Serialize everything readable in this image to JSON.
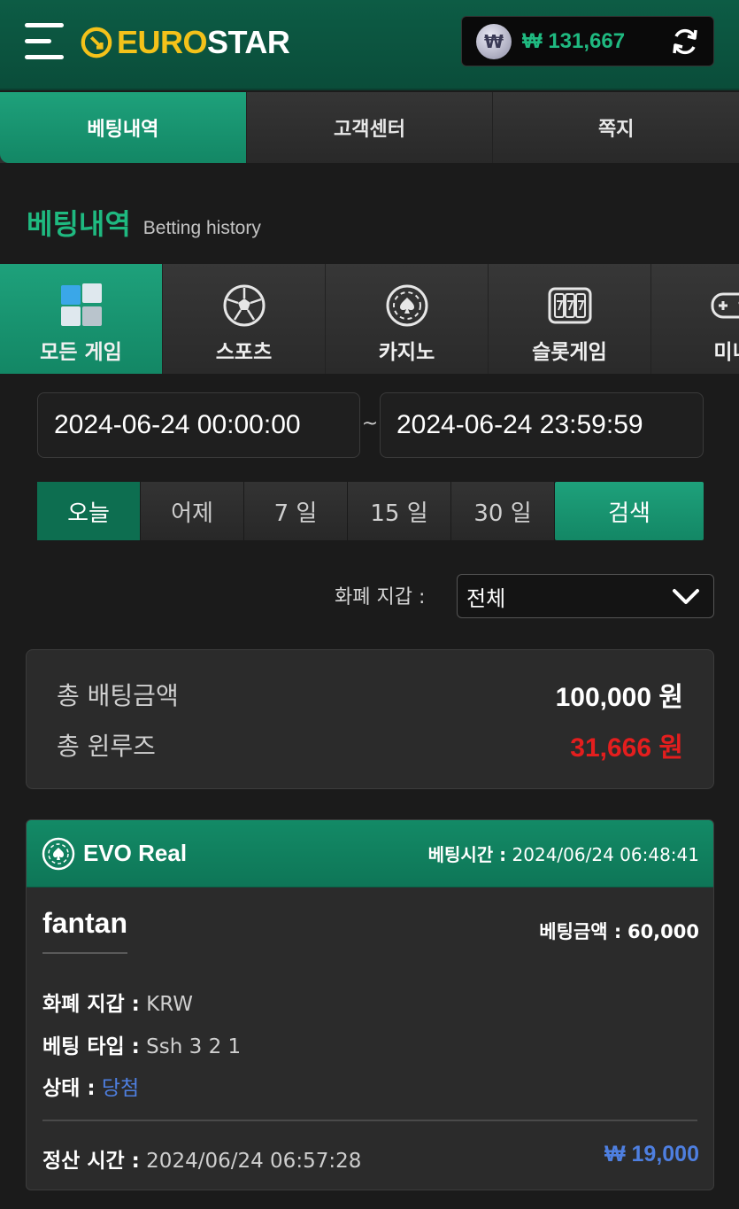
{
  "header": {
    "logo_euro": "EURO",
    "logo_star": "STAR",
    "currency_symbol": "₩",
    "balance": "₩ 131,667"
  },
  "top_tabs": [
    {
      "label": "베팅내역",
      "active": true
    },
    {
      "label": "고객센터",
      "active": false
    },
    {
      "label": "쪽지",
      "active": false
    }
  ],
  "section": {
    "title_kr": "베팅내역",
    "title_en": "Betting history"
  },
  "categories": [
    {
      "label": "모든 게임",
      "icon": "all-games-icon",
      "active": true
    },
    {
      "label": "스포츠",
      "icon": "soccer-ball-icon",
      "active": false
    },
    {
      "label": "카지노",
      "icon": "casino-chip-icon",
      "active": false
    },
    {
      "label": "슬롯게임",
      "icon": "slot-machine-icon",
      "active": false
    },
    {
      "label": "미니",
      "icon": "gamepad-icon",
      "active": false
    }
  ],
  "filters": {
    "date_start": "2024-06-24 00:00:00",
    "date_separator": "~",
    "date_end": "2024-06-24 23:59:59",
    "periods": [
      "오늘",
      "어제",
      "7 일",
      "15 일",
      "30 일"
    ],
    "search_label": "검색",
    "wallet_label": "화폐 지갑 :",
    "wallet_value": "전체"
  },
  "summary": {
    "total_bet_label": "총 배팅금액",
    "total_bet_value": "100,000 원",
    "total_rolling_label": "총 윈루즈",
    "total_rolling_value": "31,666 원"
  },
  "bet_card": {
    "provider": "EVO Real",
    "bet_time_label": "베팅시간 :",
    "bet_time": "2024/06/24 06:48:41",
    "game_name": "fantan",
    "bet_amount_label": "베팅금액 :",
    "bet_amount": "60,000",
    "wallet_label": "화폐 지갑 :",
    "wallet": "KRW",
    "bet_type_label": "베팅 타입 :",
    "bet_type": "Ssh 3 2 1",
    "status_label": "상태 :",
    "status": "당첨",
    "settle_label": "정산 시간 :",
    "settle_time": "2024/06/24 06:57:28",
    "win_amount": "₩ 19,000"
  },
  "colors": {
    "brand_green": "#1ea17b",
    "dark_green": "#0d5c45",
    "loss_red": "#e41e1e",
    "win_blue": "#4e7fe0",
    "logo_yellow": "#f4c21a"
  }
}
